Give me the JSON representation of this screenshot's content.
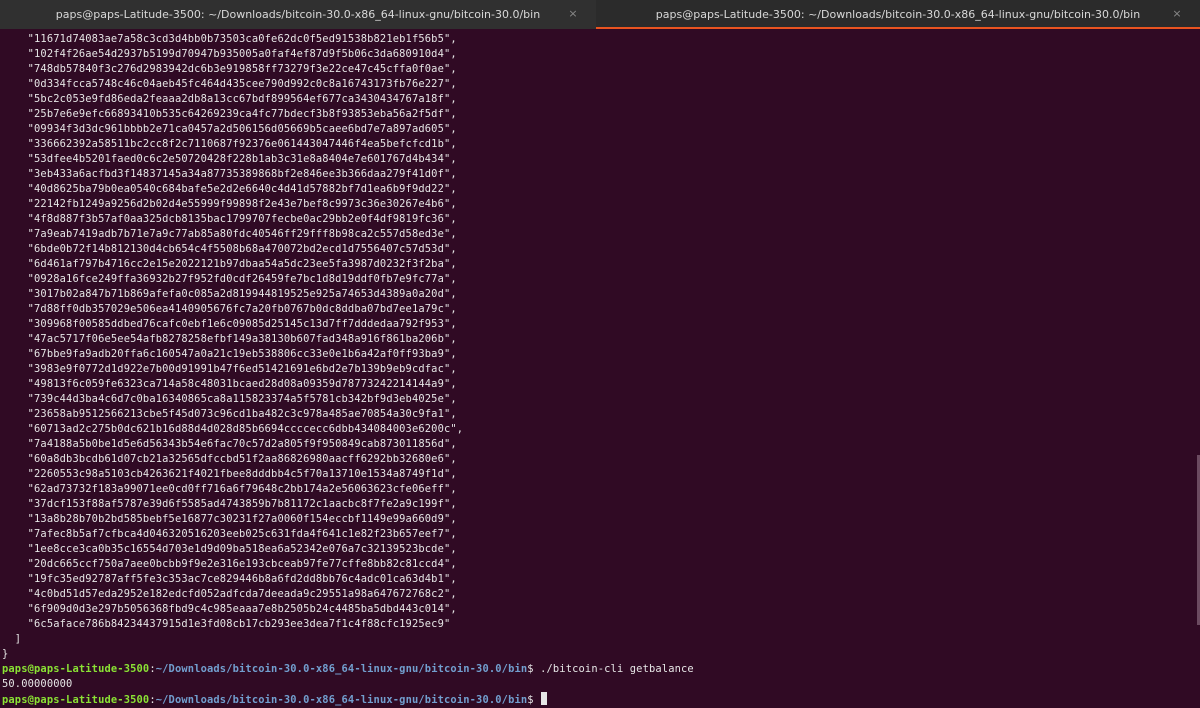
{
  "tabs": [
    {
      "title": "paps@paps-Latitude-3500: ~/Downloads/bitcoin-30.0-x86_64-linux-gnu/bitcoin-30.0/bin",
      "close": "×",
      "active": false
    },
    {
      "title": "paps@paps-Latitude-3500: ~/Downloads/bitcoin-30.0-x86_64-linux-gnu/bitcoin-30.0/bin",
      "close": "×",
      "active": true
    }
  ],
  "terminal": {
    "hashes": [
      "11671d74083ae7a58c3cd3d4bb0b73503ca0fe62dc0f5ed91538b821eb1f56b5",
      "102f4f26ae54d2937b5199d70947b935005a0faf4ef87d9f5b06c3da680910d4",
      "748db57840f3c276d2983942dc6b3e919858ff73279f3e22ce47c45cffa0f0ae",
      "0d334fcca5748c46c04aeb45fc464d435cee790d992c0c8a16743173fb76e227",
      "5bc2c053e9fd86eda2feaaa2db8a13cc67bdf899564ef677ca3430434767a18f",
      "25b7e6e9efc66893410b535c64269239ca4fc77bdecf3b8f93853eba56a2f5df",
      "09934f3d3dc961bbbb2e71ca0457a2d506156d05669b5caee6bd7e7a897ad605",
      "336662392a58511bc2cc8f2c7110687f92376e061443047446f4ea5befcfcd1b",
      "53dfee4b5201faed0c6c2e50720428f228b1ab3c31e8a8404e7e601767d4b434",
      "3eb433a6acfbd3f14837145a34a87735389868bf2e846ee3b366daa279f41d0f",
      "40d8625ba79b0ea0540c684bafe5e2d2e6640c4d41d57882bf7d1ea6b9f9dd22",
      "22142fb1249a9256d2b02d4e55999f99898f2e43e7bef8c9973c36e30267e4b6",
      "4f8d887f3b57af0aa325dcb8135bac1799707fecbe0ac29bb2e0f4df9819fc36",
      "7a9eab7419adb7b71e7a9c77ab85a80fdc40546ff29fff8b98ca2c557d58ed3e",
      "6bde0b72f14b812130d4cb654c4f5508b68a470072bd2ecd1d7556407c57d53d",
      "6d461af797b4716cc2e15e2022121b97dbaa54a5dc23ee5fa3987d0232f3f2ba",
      "0928a16fce249ffa36932b27f952fd0cdf26459fe7bc1d8d19ddf0fb7e9fc77a",
      "3017b02a847b71b869afefa0c085a2d819944819525e925a74653d4389a0a20d",
      "7d88ff0db357029e506ea4140905676fc7a20fb0767b0dc8ddba07bd7ee1a79c",
      "309968f00585ddbed76cafc0ebf1e6c09085d25145c13d7ff7dddedaa792f953",
      "47ac5717f06e5ee54afb8278258efbf149a38130b607fad348a916f861ba206b",
      "67bbe9fa9adb20ffa6c160547a0a21c19eb538806cc33e0e1b6a42af0ff93ba9",
      "3983e9f0772d1d922e7b00d91991b47f6ed51421691e6bd2e7b139b9eb9cdfac",
      "49813f6c059fe6323ca714a58c48031bcaed28d08a09359d78773242214144a9",
      "739c44d3ba4c6d7c0ba16340865ca8a115823374a5f5781cb342bf9d3eb4025e",
      "23658ab9512566213cbe5f45d073c96cd1ba482c3c978a485ae70854a30c9fa1",
      "60713ad2c275b0dc621b16d88d4d028d85b6694ccccecc6dbb434084003e6200c",
      "7a4188a5b0be1d5e6d56343b54e6fac70c57d2a805f9f950849cab873011856d",
      "60a8db3bcdb61d07cb21a32565dfccbd51f2aa86826980aacff6292bb32680e6",
      "2260553c98a5103cb4263621f4021fbee8dddbb4c5f70a13710e1534a8749f1d",
      "62ad73732f183a99071ee0cd0ff716a6f79648c2bb174a2e56063623cfe06eff",
      "37dcf153f88af5787e39d6f5585ad4743859b7b81172c1aacbc8f7fe2a9c199f",
      "13a8b28b70b2bd585bebf5e16877c30231f27a0060f154eccbf1149e99a660d9",
      "7afec8b5af7cfbca4d046320516203eeb025c631fda4f641c1e82f23b657eef7",
      "1ee8cce3ca0b35c16554d703e1d9d09ba518ea6a52342e076a7c32139523bcde",
      "20dc665ccf750a7aee0bcbb9f9e2e316e193cbceab97fe77cffe8bb82c81ccd4",
      "19fc35ed92787aff5fe3c353ac7ce829446b8a6fd2dd8bb76c4adc01ca63d4b1",
      "4c0bd51d57eda2952e182edcfd052adfcda7deeada9c29551a98a647672768c2",
      "6f909d0d3e297b5056368fbd9c4c985eaaa7e8b2505b24c4485ba5dbd443c014",
      "6c5aface786b84234437915d1e3fd08cb17cb293ee3dea7f1c4f88cfc1925ec9"
    ],
    "close_bracket": "  ]",
    "close_brace": "}",
    "prompt_user": "paps@paps-Latitude-3500",
    "prompt_sep": ":",
    "prompt_path": "~/Downloads/bitcoin-30.0-x86_64-linux-gnu/bitcoin-30.0/bin",
    "prompt_dollar": "$ ",
    "command": "./bitcoin-cli getbalance",
    "output": "50.00000000"
  }
}
